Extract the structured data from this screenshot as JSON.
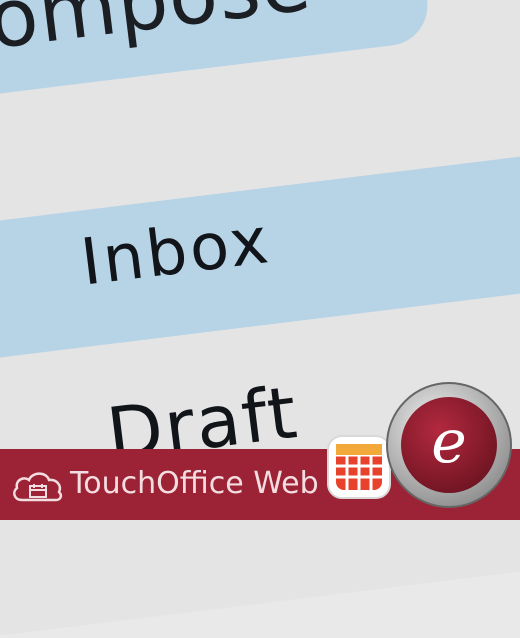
{
  "nav": {
    "compose_label": "Compose",
    "inbox_label": "Inbox",
    "draft_label": "Draft"
  },
  "brand": {
    "name": "TouchOffice Web",
    "bar_color": "#9b2335",
    "accent_color": "#b7d3e6",
    "logo_letter": "e"
  },
  "icons": {
    "cloud": "cloud-icon",
    "grid": "grid-icon",
    "logo": "e-logo-icon"
  }
}
